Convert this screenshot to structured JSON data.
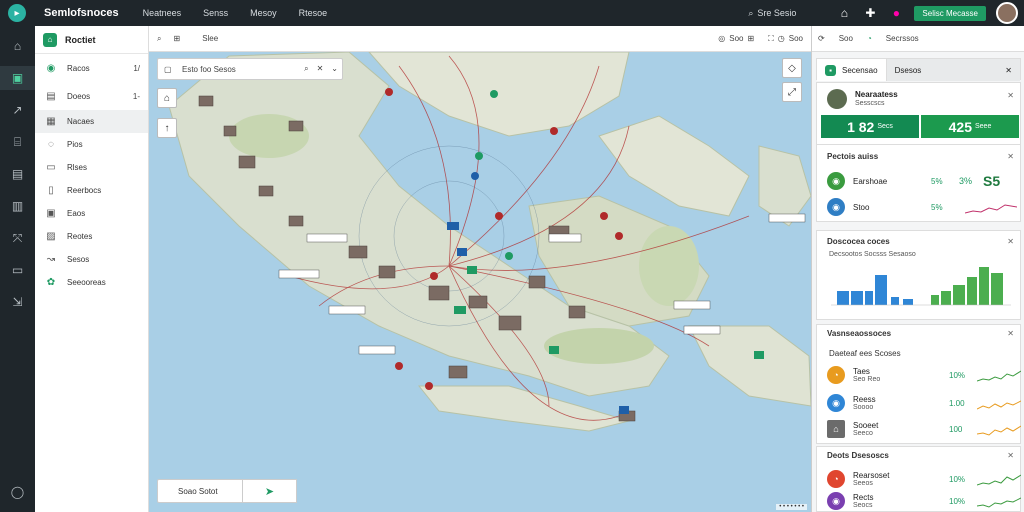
{
  "topbar": {
    "title": "Semlofsnoces",
    "nav": [
      "Neatnees",
      "Senss",
      "Mesoy",
      "Rtesoe"
    ],
    "search_hint": "Sre Sesio",
    "badge": "Selisc Mecasse"
  },
  "navpanel": {
    "header": "Roctiet",
    "items": [
      {
        "label": "Racos",
        "count": "1/"
      },
      {
        "label": "Doeos",
        "count": "1-"
      },
      {
        "label": "Nacaes",
        "count": ""
      },
      {
        "label": "Pios",
        "count": ""
      },
      {
        "label": "Rlses",
        "count": ""
      },
      {
        "label": "Reerbocs",
        "count": ""
      },
      {
        "label": "Eaos",
        "count": ""
      },
      {
        "label": "Reotes",
        "count": ""
      },
      {
        "label": "Sesos",
        "count": ""
      },
      {
        "label": "Seeooreas",
        "count": ""
      }
    ]
  },
  "map": {
    "toolbar_left": "Slee",
    "toolbar_right1": "Soo",
    "toolbar_right2": "Soo",
    "search_text": "Esto foo   Sesos",
    "bottom_search": "Soao Sotot"
  },
  "rpanel": {
    "toolbar": [
      "Soo",
      "Secrssos"
    ],
    "tabs": [
      "Secensao",
      "Dsesos"
    ],
    "profile_name": "Nearaatess",
    "profile_sub": "Sesscscs",
    "stat1": "1 82",
    "stat1_unit": "Secs",
    "stat2": "425",
    "stat2_unit": "Seee",
    "card2_title": "Pectois auiss",
    "card2_rows": [
      {
        "label": "Earshoae",
        "pct": "5%",
        "big": "S5",
        "extra": "3%"
      },
      {
        "label": "Stoo",
        "pct": "5%",
        "big": "",
        "extra": ""
      }
    ],
    "card3_title": "Doscocea coces",
    "card3_sub": "Decsootos  Socsss  Sesaoso",
    "card4_title": "Vasnseaossoces",
    "card4_sub": "Daeteaf ees Scoses",
    "card4_rows": [
      {
        "label": "Taes",
        "sub": "Seo Reo",
        "pct": "10%"
      },
      {
        "label": "Reess",
        "sub": "Soooo",
        "pct": "1.00"
      },
      {
        "label": "Sooeet",
        "sub": "Seeco",
        "pct": "100"
      }
    ],
    "card5_title": "Deots Dsesoscs",
    "card5_rows": [
      {
        "label": "Rearsoset",
        "sub": "Seeos",
        "pct": "10%"
      },
      {
        "label": "Rects",
        "sub": "Seocs",
        "pct": "10%"
      }
    ]
  }
}
